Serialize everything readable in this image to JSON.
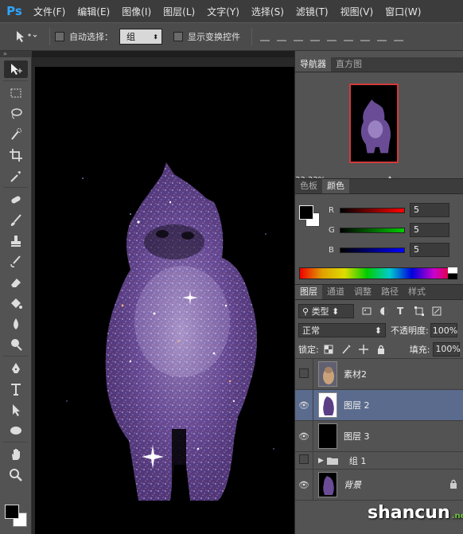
{
  "app": {
    "logo": "Ps"
  },
  "menu": [
    "文件(F)",
    "编辑(E)",
    "图像(I)",
    "图层(L)",
    "文字(Y)",
    "选择(S)",
    "滤镜(T)",
    "视图(V)",
    "窗口(W)"
  ],
  "options": {
    "auto_select_label": "自动选择：",
    "auto_select_value": "组",
    "show_transform_label": "显示变换控件"
  },
  "toolbar": {
    "tools": [
      "move-tool-icon",
      "marquee-tool-icon",
      "lasso-tool-icon",
      "quick-select-tool-icon",
      "crop-tool-icon",
      "eyedropper-tool-icon",
      "healing-tool-icon",
      "brush-tool-icon",
      "clone-stamp-tool-icon",
      "history-brush-tool-icon",
      "eraser-tool-icon",
      "paint-bucket-tool-icon",
      "blur-tool-icon",
      "dodge-tool-icon",
      "pen-tool-icon",
      "type-tool-icon",
      "path-select-tool-icon",
      "ellipse-tool-icon",
      "hand-tool-icon",
      "zoom-tool-icon"
    ],
    "foreground_color": "#000000",
    "background_color": "#ffffff"
  },
  "navigator": {
    "tabs": [
      "导航器",
      "直方图"
    ],
    "active_tab": "导航器",
    "zoom": "33.33%"
  },
  "color_panel": {
    "tabs": [
      "色板",
      "颜色"
    ],
    "active_tab": "颜色",
    "r_label": "R",
    "r_value": "5",
    "g_label": "G",
    "g_value": "5",
    "b_label": "B",
    "b_value": "5"
  },
  "layers_panel": {
    "tabs": [
      "图层",
      "通道",
      "调整",
      "路径",
      "样式"
    ],
    "active_tab": "图层",
    "filter_type": "类型",
    "blend_mode": "正常",
    "opacity_label": "不透明度:",
    "opacity_value": "100%",
    "lock_label": "锁定:",
    "fill_label": "填充:",
    "fill_value": "100%",
    "layers": [
      {
        "name": "素材2",
        "visible": false,
        "selected": false
      },
      {
        "name": "图层 2",
        "visible": true,
        "selected": true
      },
      {
        "name": "图层 3",
        "visible": true,
        "selected": false
      },
      {
        "name": "组 1",
        "visible": false,
        "selected": false
      },
      {
        "name": "背景",
        "visible": true,
        "selected": false
      }
    ]
  },
  "watermark": {
    "text": "shancun",
    "tld": ".net"
  }
}
